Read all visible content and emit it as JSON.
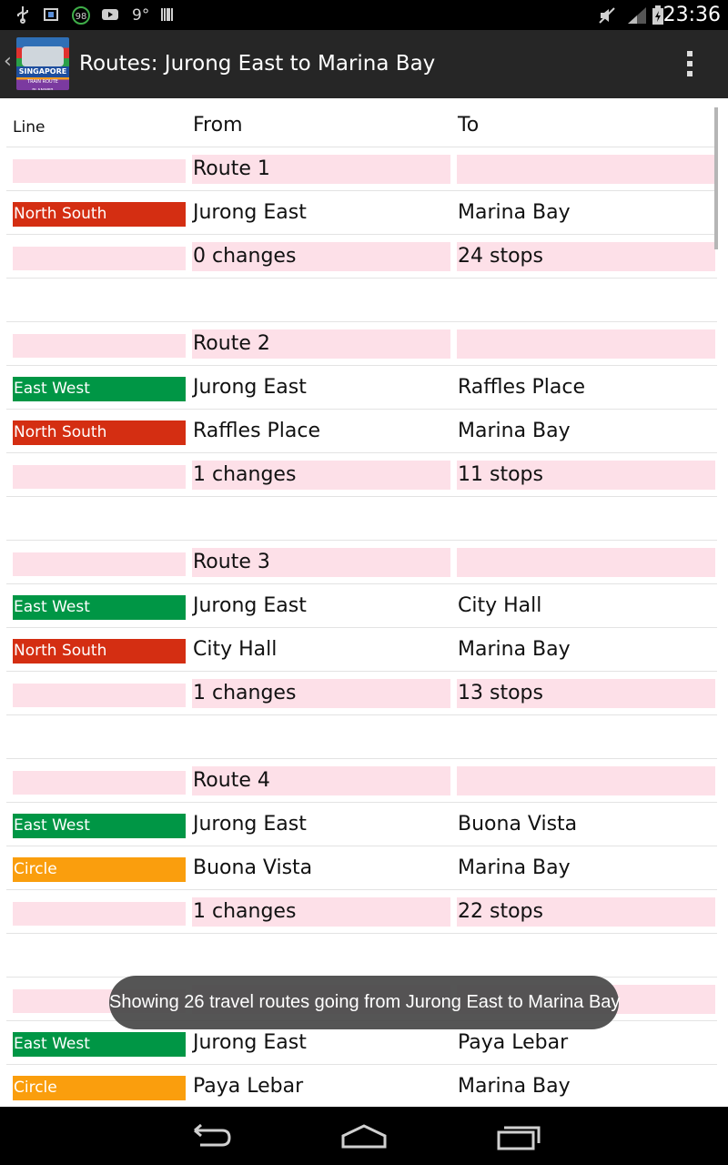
{
  "status_bar": {
    "time": "23:36",
    "temperature": "9°",
    "badge": "98",
    "icons": [
      "usb-icon",
      "sd-card-icon",
      "badge-98-icon",
      "youtube-icon",
      "barcode-icon",
      "mute-icon",
      "signal-icon",
      "battery-icon"
    ]
  },
  "action_bar": {
    "title": "Routes: Jurong East to Marina Bay",
    "logo_text": "SINGAPORE",
    "logo_subtext": "TRAIN ROUTE PLANNER"
  },
  "table": {
    "headers": {
      "line": "Line",
      "from": "From",
      "to": "To"
    },
    "line_colors": {
      "North South": "#d42e12",
      "East West": "#009645",
      "Circle": "#fa9e0d"
    },
    "rows": [
      {
        "kind": "route",
        "line": "",
        "from": "Route 1",
        "to": ""
      },
      {
        "kind": "leg",
        "line": "North South",
        "from": "Jurong East",
        "to": "Marina Bay"
      },
      {
        "kind": "summary",
        "line": "",
        "from": "0 changes",
        "to": "24 stops"
      },
      {
        "kind": "gap",
        "line": "",
        "from": "",
        "to": ""
      },
      {
        "kind": "route",
        "line": "",
        "from": "Route 2",
        "to": ""
      },
      {
        "kind": "leg",
        "line": "East West",
        "from": "Jurong East",
        "to": "Raffles Place"
      },
      {
        "kind": "leg",
        "line": "North South",
        "from": "Raffles Place",
        "to": "Marina Bay"
      },
      {
        "kind": "summary",
        "line": "",
        "from": "1 changes",
        "to": "11 stops"
      },
      {
        "kind": "gap",
        "line": "",
        "from": "",
        "to": ""
      },
      {
        "kind": "route",
        "line": "",
        "from": "Route 3",
        "to": ""
      },
      {
        "kind": "leg",
        "line": "East West",
        "from": "Jurong East",
        "to": "City Hall"
      },
      {
        "kind": "leg",
        "line": "North South",
        "from": "City Hall",
        "to": "Marina Bay"
      },
      {
        "kind": "summary",
        "line": "",
        "from": "1 changes",
        "to": "13 stops"
      },
      {
        "kind": "gap",
        "line": "",
        "from": "",
        "to": ""
      },
      {
        "kind": "route",
        "line": "",
        "from": "Route 4",
        "to": ""
      },
      {
        "kind": "leg",
        "line": "East West",
        "from": "Jurong East",
        "to": "Buona Vista"
      },
      {
        "kind": "leg",
        "line": "Circle",
        "from": "Buona Vista",
        "to": "Marina Bay"
      },
      {
        "kind": "summary",
        "line": "",
        "from": "1 changes",
        "to": "22 stops"
      },
      {
        "kind": "gap",
        "line": "",
        "from": "",
        "to": ""
      },
      {
        "kind": "route",
        "line": "",
        "from": "",
        "to": ""
      },
      {
        "kind": "leg",
        "line": "East West",
        "from": "Jurong East",
        "to": "Paya Lebar"
      },
      {
        "kind": "leg",
        "line": "Circle",
        "from": "Paya Lebar",
        "to": "Marina Bay"
      }
    ]
  },
  "toast": {
    "message": "Showing 26 travel routes going from Jurong East to Marina Bay"
  },
  "nav_bar": {
    "buttons": [
      "back-icon",
      "home-icon",
      "recent-apps-icon"
    ]
  }
}
